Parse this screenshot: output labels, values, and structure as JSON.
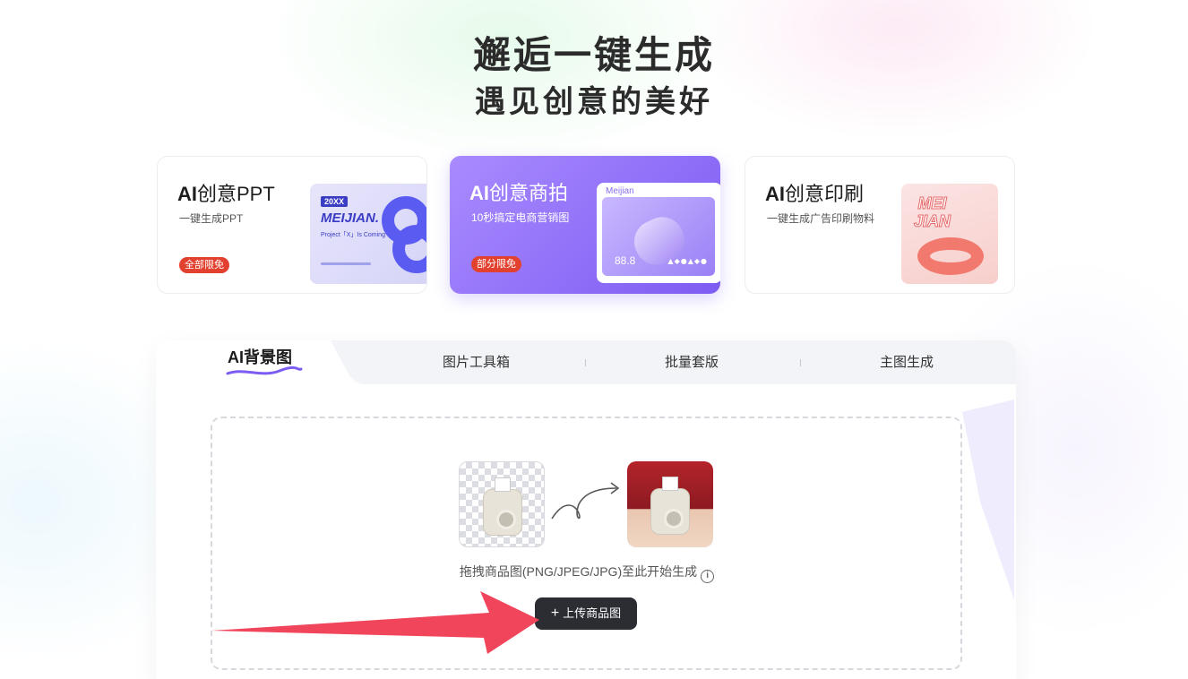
{
  "hero": {
    "line1": "邂逅一键生成",
    "line2": "遇见创意的美好"
  },
  "cards": [
    {
      "title_prefix": "AI",
      "title_main": "创意PPT",
      "subtitle": "一键生成PPT",
      "badge": "全部限免",
      "thumb": {
        "small": "20XX",
        "big": "MEIJIAN.",
        "tiny": "Project「X」Is Coming"
      }
    },
    {
      "title_prefix": "AI",
      "title_main": "创意商拍",
      "subtitle": "10秒搞定电商营销图",
      "badge": "部分限免",
      "thumb": {
        "label": "Meijian",
        "price": "88.8",
        "shapes": "▲◆●▲◆●"
      }
    },
    {
      "title_prefix": "AI",
      "title_main": "创意印刷",
      "subtitle": "一键生成广告印刷物料",
      "thumb": {
        "logo_line1": "MEI",
        "logo_line2": "JIAN"
      }
    }
  ],
  "tabs": [
    {
      "label": "AI背景图",
      "active": true
    },
    {
      "label": "图片工具箱"
    },
    {
      "label": "批量套版"
    },
    {
      "label": "主图生成"
    }
  ],
  "dropzone": {
    "hint": "拖拽商品图(PNG/JPEG/JPG)至此开始生成",
    "info_icon": "i",
    "upload_label": "上传商品图",
    "upload_icon": "+"
  },
  "colors": {
    "badge_red": "#e3412f",
    "accent_purple": "#7d5cf2",
    "annotation_arrow": "#f0455a",
    "upload_bg": "#2b2d33"
  }
}
